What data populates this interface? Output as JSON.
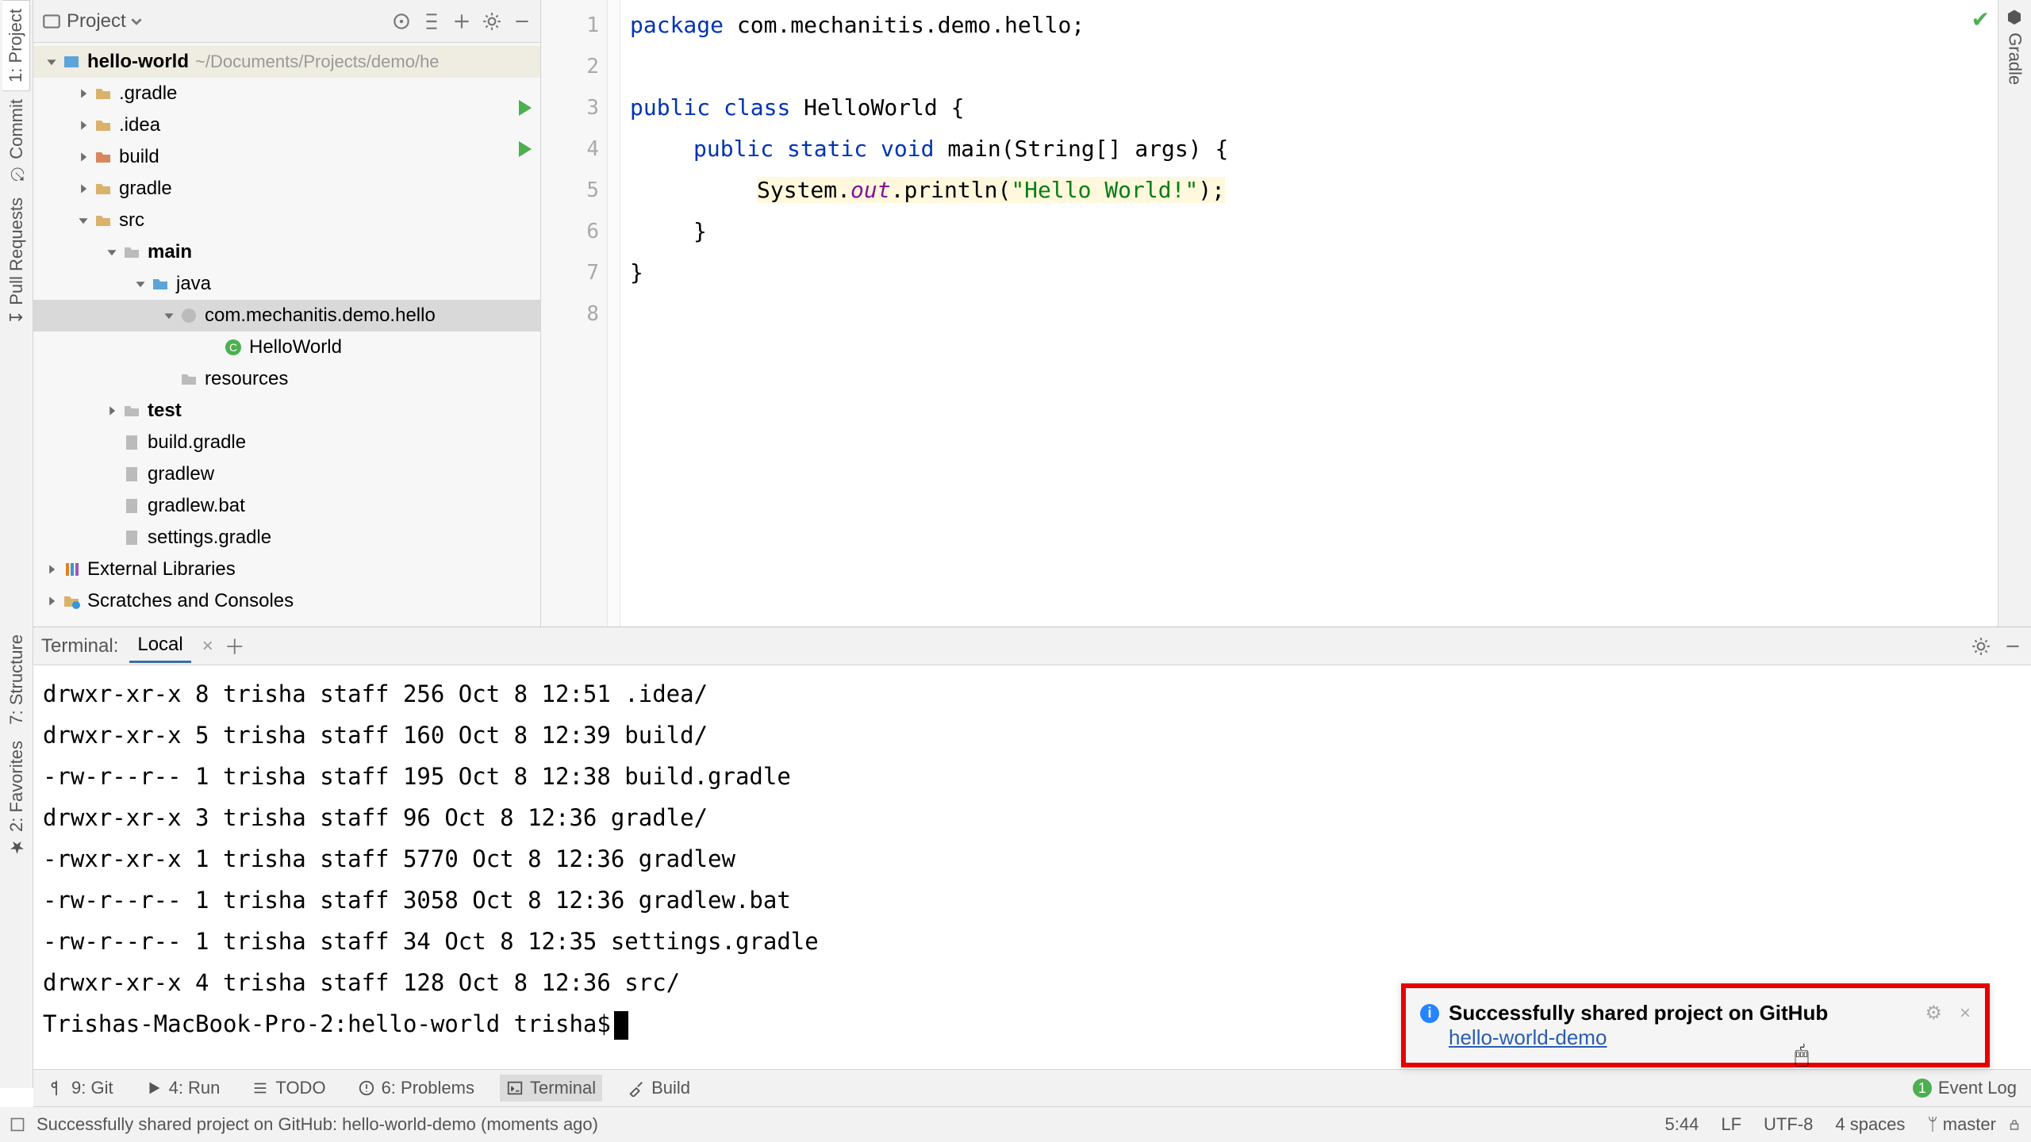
{
  "left_tabs": {
    "project": "1: Project",
    "commit": "Commit",
    "pull": "Pull Requests"
  },
  "left_tabs2": {
    "structure": "7: Structure",
    "favorites": "2: Favorites"
  },
  "right_tabs": {
    "gradle": "Gradle"
  },
  "project_panel": {
    "title": "Project",
    "root": {
      "name": "hello-world",
      "hint": "~/Documents/Projects/demo/he"
    },
    "nodes": {
      "gradle_dot": ".gradle",
      "idea": ".idea",
      "build": "build",
      "gradle": "gradle",
      "src": "src",
      "main": "main",
      "java": "java",
      "pkg": "com.mechanitis.demo.hello",
      "helloworld": "HelloWorld",
      "resources": "resources",
      "test": "test",
      "build_gradle": "build.gradle",
      "gradlew": "gradlew",
      "gradlew_bat": "gradlew.bat",
      "settings_gradle": "settings.gradle",
      "ext_libs": "External Libraries",
      "scratches": "Scratches and Consoles"
    }
  },
  "code": {
    "l1a": "package",
    "l1b": " com.mechanitis.demo.hello;",
    "l3a": "public",
    "l3b": " class",
    "l3c": " HelloWorld {",
    "l4a": "public",
    "l4b": " static",
    "l4c": " void",
    "l4d": " main",
    "l4e": "(String[] args) {",
    "l5a": "System.",
    "l5b": "out",
    "l5c": ".println(",
    "l5d": "\"Hello World!\"",
    "l5e": ");",
    "l6": "}",
    "l7": "}",
    "lines": {
      "1": "1",
      "2": "2",
      "3": "3",
      "4": "4",
      "5": "5",
      "6": "6",
      "7": "7",
      "8": "8"
    }
  },
  "terminal": {
    "label": "Terminal:",
    "tab": "Local",
    "lines": [
      "drwxr-xr-x   8 trisha  staff   256 Oct  8 12:51 .idea/",
      "drwxr-xr-x   5 trisha  staff   160 Oct  8 12:39 build/",
      "-rw-r--r--   1 trisha  staff   195 Oct  8 12:38 build.gradle",
      "drwxr-xr-x   3 trisha  staff    96 Oct  8 12:36 gradle/",
      "-rwxr-xr-x   1 trisha  staff  5770 Oct  8 12:36 gradlew",
      "-rw-r--r--   1 trisha  staff  3058 Oct  8 12:36 gradlew.bat",
      "-rw-r--r--   1 trisha  staff    34 Oct  8 12:35 settings.gradle",
      "drwxr-xr-x   4 trisha  staff   128 Oct  8 12:36 src/"
    ],
    "prompt": "Trishas-MacBook-Pro-2:hello-world trisha$"
  },
  "bottom_tools": {
    "git": "9: Git",
    "run": "4: Run",
    "todo": "TODO",
    "problems": "6: Problems",
    "terminal": "Terminal",
    "build": "Build",
    "event_log": "Event Log"
  },
  "status": {
    "msg": "Successfully shared project on GitHub: hello-world-demo (moments ago)",
    "pos": "5:44",
    "sep": "LF",
    "enc": "UTF-8",
    "indent": "4 spaces",
    "branch": "master"
  },
  "notification": {
    "title": "Successfully shared project on GitHub",
    "link": "hello-world-demo"
  }
}
